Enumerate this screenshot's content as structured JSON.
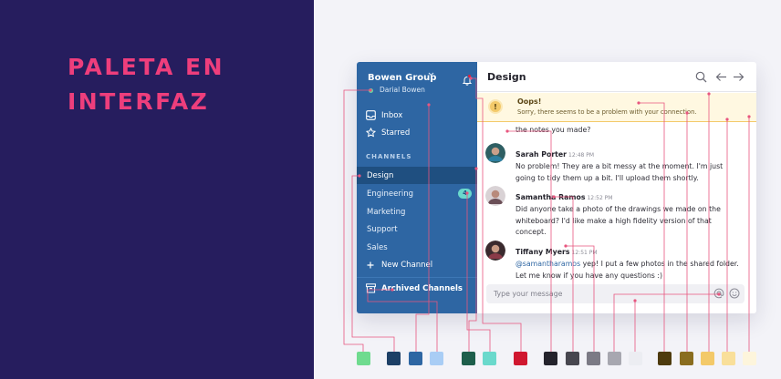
{
  "headline": {
    "line1": "PALETA EN",
    "line2": "INTERFAZ"
  },
  "sidebar": {
    "team_name": "Bowen Group",
    "team_caret_icon": "chevron-down-icon",
    "user_name": "Darial Bowen",
    "nav": [
      {
        "label": "Inbox",
        "icon": "inbox-icon"
      },
      {
        "label": "Starred",
        "icon": "star-icon"
      }
    ],
    "section_label": "CHANNELS",
    "channels": [
      {
        "label": "Design",
        "active": true,
        "badge": ""
      },
      {
        "label": "Engineering",
        "active": false,
        "badge": "4"
      },
      {
        "label": "Marketing",
        "active": false,
        "badge": ""
      },
      {
        "label": "Support",
        "active": false,
        "badge": ""
      },
      {
        "label": "Sales",
        "active": false,
        "badge": ""
      }
    ],
    "new_channel": "New Channel",
    "archived": "Archived Channels"
  },
  "main": {
    "title": "Design",
    "alert": {
      "title": "Oops!",
      "text": "Sorry, there seems to be a problem with your connection.",
      "icon_text": "!"
    },
    "partial_line": "the notes you made?",
    "messages": [
      {
        "author": "Sarah Porter",
        "time": "12:48 PM",
        "text": "No problem! They are a bit messy at the moment. I'm just going to tidy them up a bit. I'll upload them shortly."
      },
      {
        "author": "Samantha Ramos",
        "time": "12:52 PM",
        "text": "Did anyone take a photo of the drawings we made on the whiteboard? I'd like make a high fidelity version of that concept."
      },
      {
        "author": "Tiffany Myers",
        "time": "12:51 PM",
        "mention": "@samantharamos",
        "text": " yep! I put a few photos in the shared folder. Let me know if you have any questions :)"
      }
    ],
    "composer_placeholder": "Type your message"
  },
  "palette": [
    "#6fdb8f",
    "#1d3f66",
    "#2e66a3",
    "#a9cdf5",
    "#1d5e4b",
    "#6ad9cc",
    "#d0172f",
    "#24232c",
    "#47464f",
    "#7b7a85",
    "#a7a7b0",
    "#ecedf2",
    "#4e3b0e",
    "#8a6d1f",
    "#f3c969",
    "#f9df9a",
    "#fdf5dc"
  ]
}
